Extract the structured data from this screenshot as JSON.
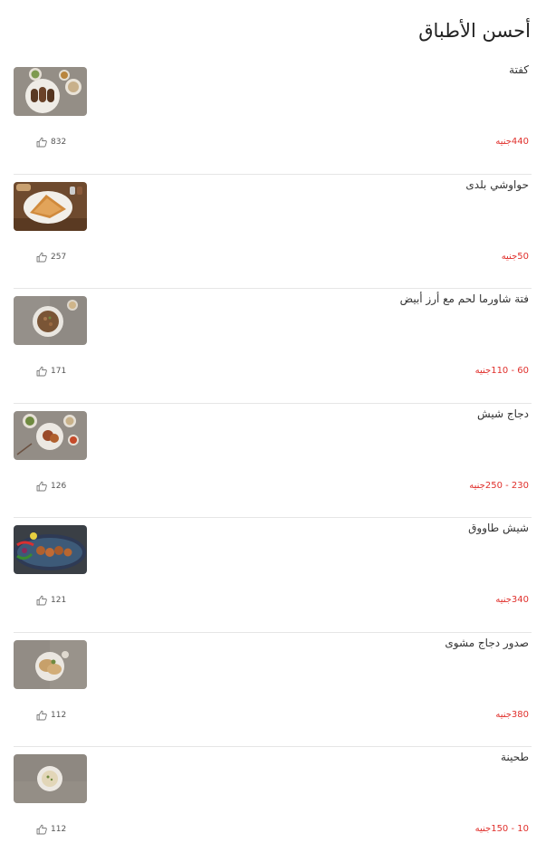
{
  "section": {
    "title": "أحسن الأطباق"
  },
  "items": [
    {
      "name": "كفتة",
      "price": "440جنيه",
      "likes": "832"
    },
    {
      "name": "حواوشي بلدى",
      "price": "50جنيه",
      "likes": "257"
    },
    {
      "name": "فتة شاورما لحم مع أرز أبيض",
      "price": "60 - 110جنيه",
      "likes": "171"
    },
    {
      "name": "دجاج شيش",
      "price": "230 - 250جنيه",
      "likes": "126"
    },
    {
      "name": "شيش طاووق",
      "price": "340جنيه",
      "likes": "121"
    },
    {
      "name": "صدور دجاج مشوى",
      "price": "380جنيه",
      "likes": "112"
    },
    {
      "name": "طحينة",
      "price": "10 - 150جنيه",
      "likes": "112"
    }
  ],
  "icons": {
    "like": "thumbs-up-icon"
  },
  "colors": {
    "price": "#e0302c",
    "divider": "#e6e6e6",
    "title": "#222222"
  }
}
